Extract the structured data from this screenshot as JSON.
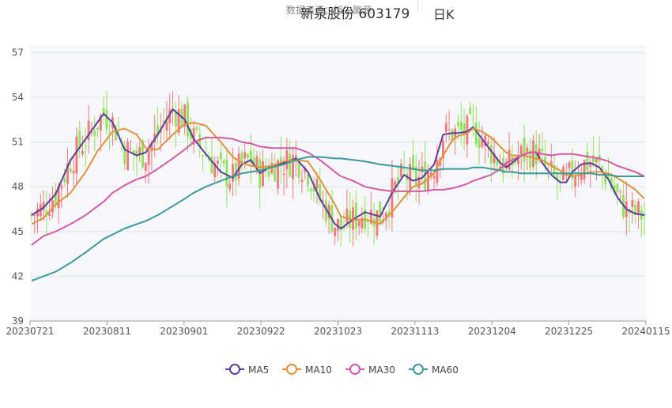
{
  "header": {
    "title": "新泉股份 603179",
    "subtitle": "数据来源：恒生聚源",
    "period": "日K"
  },
  "chart_data": {
    "type": "candlestick",
    "title": "新泉股份 603179",
    "yaxis": {
      "ticks": [
        39,
        42,
        45,
        48,
        51,
        54,
        57
      ],
      "ylim": [
        39,
        57.5
      ]
    },
    "xaxis": {
      "tick_labels": [
        "20230721",
        "20230811",
        "20230901",
        "20230922",
        "20231023",
        "20231113",
        "20231204",
        "20231225",
        "20240115"
      ]
    },
    "colors": {
      "up": "#f07a7a",
      "down": "#91e35c"
    },
    "legend": [
      {
        "name": "MA5",
        "color": "#5b3d9c"
      },
      {
        "name": "MA10",
        "color": "#e0923d"
      },
      {
        "name": "MA30",
        "color": "#d45aa6"
      },
      {
        "name": "MA60",
        "color": "#3d9999"
      }
    ],
    "series": [
      {
        "name": "MA5",
        "anchors": [
          [
            0,
            46.1
          ],
          [
            4,
            46.6
          ],
          [
            8,
            47.5
          ],
          [
            13,
            49.8
          ],
          [
            18,
            51.2
          ],
          [
            24,
            52.9
          ],
          [
            27,
            52.3
          ],
          [
            31,
            50.5
          ],
          [
            35,
            50.1
          ],
          [
            38,
            50.3
          ],
          [
            42,
            51.5
          ],
          [
            47,
            53.2
          ],
          [
            51,
            52.5
          ],
          [
            54,
            51.2
          ],
          [
            58,
            50.2
          ],
          [
            63,
            49.0
          ],
          [
            67,
            48.6
          ],
          [
            70,
            49.5
          ],
          [
            73,
            49.8
          ],
          [
            76,
            48.9
          ],
          [
            80,
            49.4
          ],
          [
            84,
            49.6
          ],
          [
            88,
            49.9
          ],
          [
            92,
            49.0
          ],
          [
            96,
            47.2
          ],
          [
            101,
            45.5
          ],
          [
            103,
            45.2
          ],
          [
            107,
            45.8
          ],
          [
            111,
            46.3
          ],
          [
            116,
            46.0
          ],
          [
            120,
            47.6
          ],
          [
            124,
            48.8
          ],
          [
            127,
            48.4
          ],
          [
            130,
            48.6
          ],
          [
            134,
            49.5
          ],
          [
            137,
            51.5
          ],
          [
            140,
            51.6
          ],
          [
            142,
            51.6
          ],
          [
            145,
            51.7
          ],
          [
            147,
            52.0
          ],
          [
            150,
            51.2
          ],
          [
            153,
            50.4
          ],
          [
            156,
            49.6
          ],
          [
            158,
            49.3
          ],
          [
            160,
            49.6
          ],
          [
            163,
            50.1
          ],
          [
            166,
            50.3
          ],
          [
            168,
            50.3
          ],
          [
            170,
            49.6
          ],
          [
            173,
            48.8
          ],
          [
            176,
            48.3
          ],
          [
            178,
            48.3
          ],
          [
            180,
            49.0
          ],
          [
            183,
            49.5
          ],
          [
            186,
            49.6
          ],
          [
            189,
            49.3
          ],
          [
            192,
            48.5
          ],
          [
            195,
            47.3
          ],
          [
            198,
            46.5
          ],
          [
            201,
            46.2
          ],
          [
            204,
            46.1
          ]
        ]
      },
      {
        "name": "MA10",
        "anchors": [
          [
            0,
            45.5
          ],
          [
            4,
            45.9
          ],
          [
            8,
            46.8
          ],
          [
            13,
            47.6
          ],
          [
            18,
            49.0
          ],
          [
            22,
            50.4
          ],
          [
            27,
            51.7
          ],
          [
            31,
            51.9
          ],
          [
            35,
            51.5
          ],
          [
            38,
            50.6
          ],
          [
            42,
            50.5
          ],
          [
            47,
            51.5
          ],
          [
            51,
            52.2
          ],
          [
            54,
            52.3
          ],
          [
            58,
            52.1
          ],
          [
            63,
            51.0
          ],
          [
            67,
            50.0
          ],
          [
            70,
            49.6
          ],
          [
            73,
            49.4
          ],
          [
            76,
            49.3
          ],
          [
            80,
            49.4
          ],
          [
            84,
            49.7
          ],
          [
            88,
            49.8
          ],
          [
            92,
            49.7
          ],
          [
            96,
            48.5
          ],
          [
            101,
            46.8
          ],
          [
            103,
            46.0
          ],
          [
            107,
            45.8
          ],
          [
            111,
            45.8
          ],
          [
            116,
            45.5
          ],
          [
            120,
            46.3
          ],
          [
            124,
            47.3
          ],
          [
            127,
            48.0
          ],
          [
            130,
            48.2
          ],
          [
            134,
            48.9
          ],
          [
            137,
            50.1
          ],
          [
            140,
            51.1
          ],
          [
            142,
            51.4
          ],
          [
            145,
            51.6
          ],
          [
            147,
            51.9
          ],
          [
            150,
            51.7
          ],
          [
            153,
            51.3
          ],
          [
            156,
            50.7
          ],
          [
            158,
            50.3
          ],
          [
            160,
            50.1
          ],
          [
            163,
            50.1
          ],
          [
            166,
            50.0
          ],
          [
            168,
            49.9
          ],
          [
            170,
            49.8
          ],
          [
            173,
            49.4
          ],
          [
            176,
            49.1
          ],
          [
            178,
            48.8
          ],
          [
            180,
            48.7
          ],
          [
            183,
            48.8
          ],
          [
            186,
            49.0
          ],
          [
            189,
            49.0
          ],
          [
            192,
            48.9
          ],
          [
            195,
            48.6
          ],
          [
            198,
            48.2
          ],
          [
            201,
            47.8
          ],
          [
            204,
            47.2
          ]
        ]
      },
      {
        "name": "MA30",
        "anchors": [
          [
            0,
            44.1
          ],
          [
            4,
            44.7
          ],
          [
            8,
            45.0
          ],
          [
            13,
            45.5
          ],
          [
            18,
            46.1
          ],
          [
            24,
            47.0
          ],
          [
            27,
            47.6
          ],
          [
            31,
            48.1
          ],
          [
            35,
            48.5
          ],
          [
            38,
            48.7
          ],
          [
            42,
            49.2
          ],
          [
            47,
            49.9
          ],
          [
            51,
            50.5
          ],
          [
            54,
            51.0
          ],
          [
            58,
            51.3
          ],
          [
            63,
            51.3
          ],
          [
            67,
            51.2
          ],
          [
            70,
            51.0
          ],
          [
            73,
            50.9
          ],
          [
            76,
            50.7
          ],
          [
            80,
            50.6
          ],
          [
            84,
            50.6
          ],
          [
            88,
            50.6
          ],
          [
            92,
            50.3
          ],
          [
            96,
            49.8
          ],
          [
            101,
            49.0
          ],
          [
            103,
            48.7
          ],
          [
            107,
            48.4
          ],
          [
            111,
            48.0
          ],
          [
            116,
            47.8
          ],
          [
            120,
            47.7
          ],
          [
            124,
            47.7
          ],
          [
            127,
            47.7
          ],
          [
            130,
            47.7
          ],
          [
            134,
            47.8
          ],
          [
            137,
            47.8
          ],
          [
            140,
            47.9
          ],
          [
            142,
            48.0
          ],
          [
            145,
            48.2
          ],
          [
            147,
            48.4
          ],
          [
            150,
            48.6
          ],
          [
            153,
            48.8
          ],
          [
            156,
            49.2
          ],
          [
            158,
            49.6
          ],
          [
            160,
            49.8
          ],
          [
            163,
            50.1
          ],
          [
            166,
            50.3
          ],
          [
            168,
            50.3
          ],
          [
            170,
            50.2
          ],
          [
            173,
            50.1
          ],
          [
            176,
            50.2
          ],
          [
            178,
            50.2
          ],
          [
            180,
            50.2
          ],
          [
            183,
            50.1
          ],
          [
            186,
            50.0
          ],
          [
            189,
            49.9
          ],
          [
            192,
            49.7
          ],
          [
            195,
            49.4
          ],
          [
            198,
            49.2
          ],
          [
            201,
            49.0
          ],
          [
            204,
            48.7
          ]
        ]
      },
      {
        "name": "MA60",
        "anchors": [
          [
            0,
            41.7
          ],
          [
            4,
            42.0
          ],
          [
            8,
            42.3
          ],
          [
            13,
            42.9
          ],
          [
            18,
            43.6
          ],
          [
            24,
            44.5
          ],
          [
            27,
            44.8
          ],
          [
            31,
            45.2
          ],
          [
            35,
            45.5
          ],
          [
            38,
            45.7
          ],
          [
            42,
            46.1
          ],
          [
            47,
            46.7
          ],
          [
            51,
            47.2
          ],
          [
            54,
            47.6
          ],
          [
            58,
            48.0
          ],
          [
            63,
            48.4
          ],
          [
            67,
            48.7
          ],
          [
            70,
            48.9
          ],
          [
            73,
            49.0
          ],
          [
            76,
            49.1
          ],
          [
            80,
            49.3
          ],
          [
            84,
            49.5
          ],
          [
            88,
            49.8
          ],
          [
            92,
            50.0
          ],
          [
            96,
            50.0
          ],
          [
            101,
            49.9
          ],
          [
            103,
            49.9
          ],
          [
            107,
            49.8
          ],
          [
            111,
            49.7
          ],
          [
            116,
            49.5
          ],
          [
            120,
            49.4
          ],
          [
            124,
            49.3
          ],
          [
            127,
            49.2
          ],
          [
            130,
            49.1
          ],
          [
            134,
            49.1
          ],
          [
            137,
            49.2
          ],
          [
            140,
            49.2
          ],
          [
            142,
            49.2
          ],
          [
            145,
            49.2
          ],
          [
            147,
            49.3
          ],
          [
            150,
            49.3
          ],
          [
            153,
            49.2
          ],
          [
            156,
            49.1
          ],
          [
            158,
            49.0
          ],
          [
            160,
            49.0
          ],
          [
            163,
            48.9
          ],
          [
            166,
            48.9
          ],
          [
            168,
            48.9
          ],
          [
            170,
            48.9
          ],
          [
            173,
            48.9
          ],
          [
            176,
            48.9
          ],
          [
            178,
            48.9
          ],
          [
            180,
            48.9
          ],
          [
            183,
            48.9
          ],
          [
            186,
            48.9
          ],
          [
            189,
            48.8
          ],
          [
            192,
            48.8
          ],
          [
            195,
            48.7
          ],
          [
            198,
            48.7
          ],
          [
            201,
            48.7
          ],
          [
            204,
            48.7
          ]
        ]
      }
    ]
  }
}
